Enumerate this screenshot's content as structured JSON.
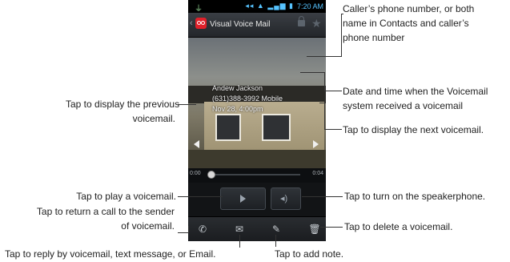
{
  "phone": {
    "status_time": "7:20 AM",
    "app_title": "Visual Voice Mail",
    "caller": {
      "name": "Andew Jackson",
      "number": "(631)388-3992 Mobile",
      "datetime": "Nov 28, 4:00pm"
    },
    "progress": {
      "start": "0:00",
      "end": "0:04"
    }
  },
  "callouts": {
    "caller_number": [
      "Caller’s phone number, or both",
      "name in Contacts and caller’s",
      "phone number"
    ],
    "date_time": [
      "Date and time when the Voicemail",
      "system received a voicemail"
    ],
    "prev": [
      "Tap to display the previous",
      "voicemail."
    ],
    "next": "Tap to display the next voicemail.",
    "play": "Tap to play a voicemail.",
    "return_call": [
      "Tap to return a call to the sender",
      "of voicemail."
    ],
    "speaker": "Tap to turn on the speakerphone.",
    "delete": "Tap to delete a voicemail.",
    "reply": "Tap to reply by voicemail, text message, or Email.",
    "add_note": "Tap to add note."
  }
}
